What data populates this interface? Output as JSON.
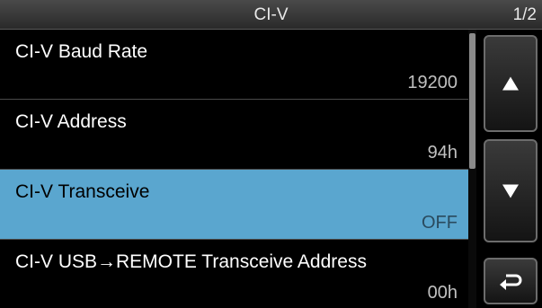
{
  "header": {
    "title": "CI-V",
    "page": "1/2"
  },
  "menu": {
    "items": [
      {
        "label": "CI-V Baud Rate",
        "value": "19200",
        "selected": false
      },
      {
        "label": "CI-V Address",
        "value": "94h",
        "selected": false
      },
      {
        "label": "CI-V Transceive",
        "value": "OFF",
        "selected": true
      },
      {
        "label": "CI-V USB→REMOTE Transceive Address",
        "value": "00h",
        "selected": false
      }
    ]
  },
  "side_buttons": {
    "up": "up-triangle-icon",
    "down": "down-triangle-icon",
    "back": "return-arrow-icon"
  },
  "scroll": {
    "fraction_visible": 0.5,
    "position": 0
  },
  "colors": {
    "selected_bg": "#5aa6cf",
    "background": "#000000"
  }
}
